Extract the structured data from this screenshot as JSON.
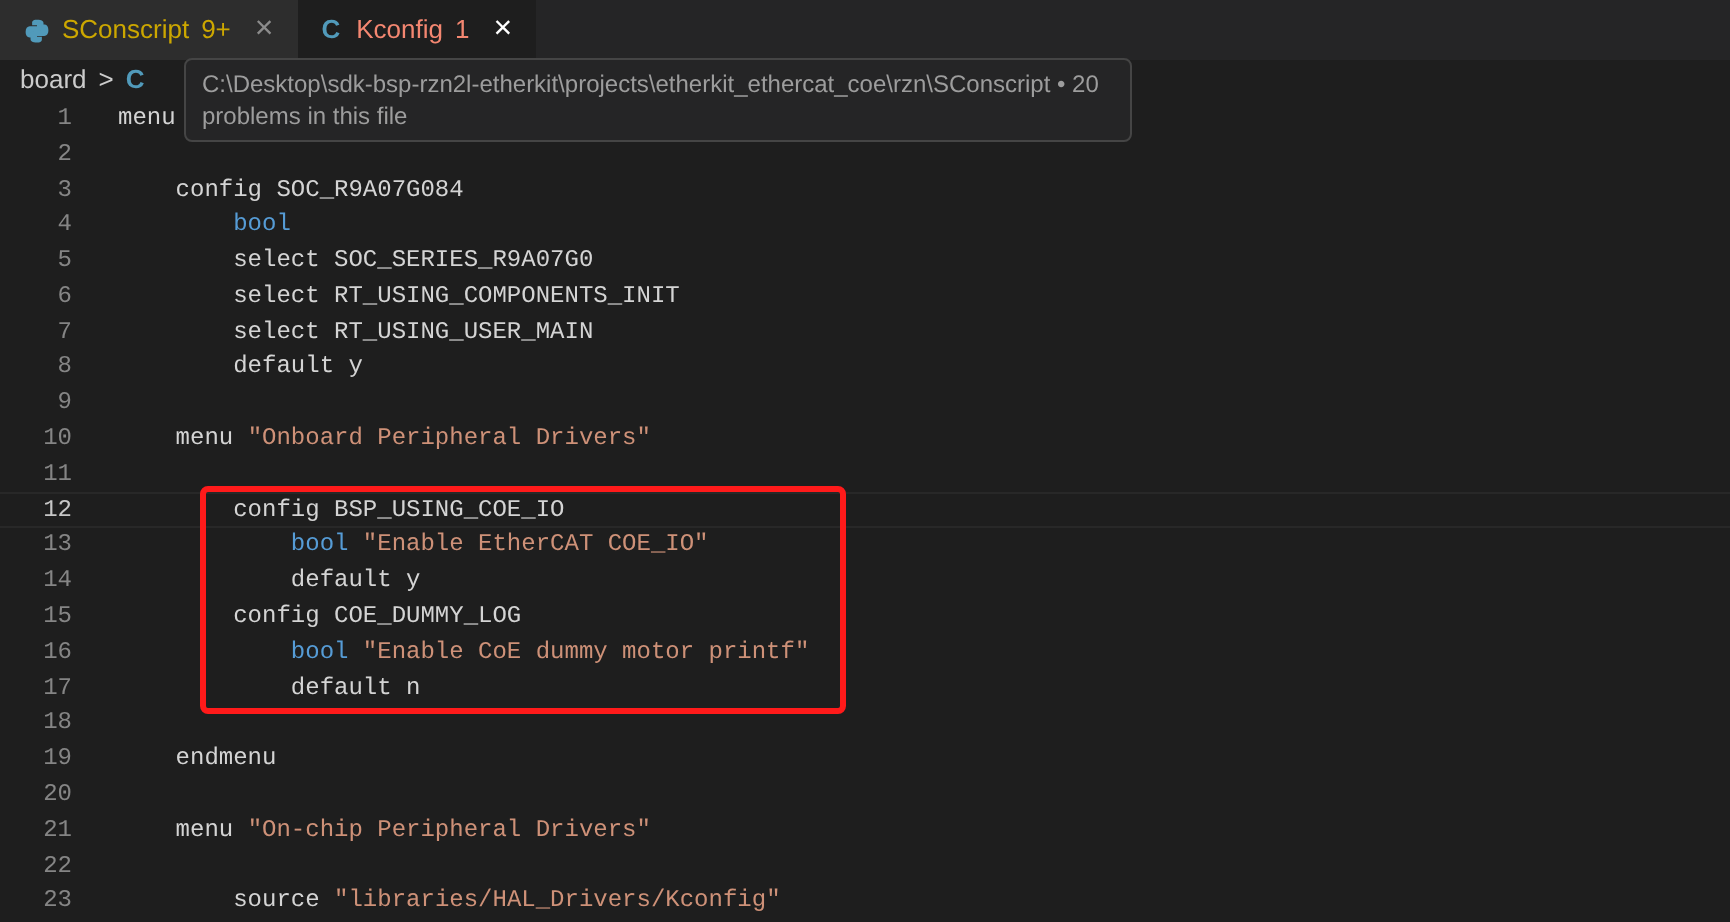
{
  "tabs": [
    {
      "kind": "python",
      "label": "SConscript",
      "badge": "9+",
      "close": "×",
      "selected": false
    },
    {
      "kind": "c",
      "icon": "C",
      "label": "Kconfig",
      "badge": "1",
      "close": "×",
      "selected": true
    }
  ],
  "breadcrumb": {
    "folder": "board",
    "separator": ">",
    "icon": "C"
  },
  "tooltip": {
    "path": "C:\\Desktop\\sdk-bsp-rzn2l-etherkit\\projects\\etherkit_ethercat_coe\\rzn\\SConscript • 20",
    "detail": "problems in this file"
  },
  "lines": [
    {
      "kind": "line",
      "number": "1",
      "selected": false,
      "tokens": [
        {
          "kind": "plain",
          "text": "menu"
        }
      ]
    },
    {
      "kind": "line",
      "number": "2",
      "selected": false
    },
    {
      "kind": "line",
      "number": "3",
      "selected": false,
      "tokens": [
        {
          "kind": "plain",
          "text": "    config SOC_R9A07G084"
        }
      ]
    },
    {
      "kind": "line",
      "number": "4",
      "selected": false,
      "tokens": [
        {
          "kind": "keyword",
          "text": "        bool"
        }
      ]
    },
    {
      "kind": "line",
      "number": "5",
      "selected": false,
      "tokens": [
        {
          "kind": "plain",
          "text": "        select SOC_SERIES_R9A07G0"
        }
      ]
    },
    {
      "kind": "line",
      "number": "6",
      "selected": false,
      "tokens": [
        {
          "kind": "plain",
          "text": "        select RT_USING_COMPONENTS_INIT"
        }
      ]
    },
    {
      "kind": "line",
      "number": "7",
      "selected": false,
      "tokens": [
        {
          "kind": "plain",
          "text": "        select RT_USING_USER_MAIN"
        }
      ]
    },
    {
      "kind": "line",
      "number": "8",
      "selected": false,
      "tokens": [
        {
          "kind": "plain",
          "text": "        default y"
        }
      ]
    },
    {
      "kind": "line",
      "number": "9",
      "selected": false
    },
    {
      "kind": "line",
      "number": "10",
      "selected": false,
      "tokens": [
        {
          "kind": "plain",
          "text": "    menu "
        },
        {
          "kind": "string",
          "text": "\"Onboard Peripheral Drivers\""
        }
      ]
    },
    {
      "kind": "line",
      "number": "11",
      "selected": false
    },
    {
      "kind": "frame",
      "lines": [
        {
          "kind": "line",
          "number": "12",
          "selected": true,
          "tokens": [
            {
              "kind": "plain",
              "text": "        config BSP_USING_COE_IO"
            }
          ]
        },
        {
          "kind": "line",
          "number": "13",
          "selected": false,
          "tokens": [
            {
              "kind": "keyword",
              "text": "            bool "
            },
            {
              "kind": "string",
              "text": "\"Enable EtherCAT COE_IO\""
            }
          ]
        },
        {
          "kind": "line",
          "number": "14",
          "selected": false,
          "tokens": [
            {
              "kind": "plain",
              "text": "            default y"
            }
          ]
        },
        {
          "kind": "line",
          "number": "15",
          "selected": false,
          "tokens": [
            {
              "kind": "plain",
              "text": "        config COE_DUMMY_LOG"
            }
          ]
        },
        {
          "kind": "line",
          "number": "16",
          "selected": false,
          "tokens": [
            {
              "kind": "keyword",
              "text": "            bool "
            },
            {
              "kind": "string",
              "text": "\"Enable CoE dummy motor printf\""
            }
          ]
        },
        {
          "kind": "line",
          "number": "17",
          "selected": false,
          "tokens": [
            {
              "kind": "plain",
              "text": "            default n"
            }
          ]
        }
      ]
    },
    {
      "kind": "line",
      "number": "18",
      "selected": false
    },
    {
      "kind": "line",
      "number": "19",
      "selected": false,
      "tokens": [
        {
          "kind": "plain",
          "text": "    endmenu"
        }
      ]
    },
    {
      "kind": "line",
      "number": "20",
      "selected": false
    },
    {
      "kind": "line",
      "number": "21",
      "selected": false,
      "tokens": [
        {
          "kind": "plain",
          "text": "    menu "
        },
        {
          "kind": "string",
          "text": "\"On-chip Peripheral Drivers\""
        }
      ]
    },
    {
      "kind": "line",
      "number": "22",
      "selected": false
    },
    {
      "kind": "line",
      "number": "23",
      "selected": false,
      "tokens": [
        {
          "kind": "plain",
          "text": "        source "
        },
        {
          "kind": "string",
          "text": "\"libraries/HAL_Drivers/Kconfig\""
        }
      ]
    }
  ]
}
